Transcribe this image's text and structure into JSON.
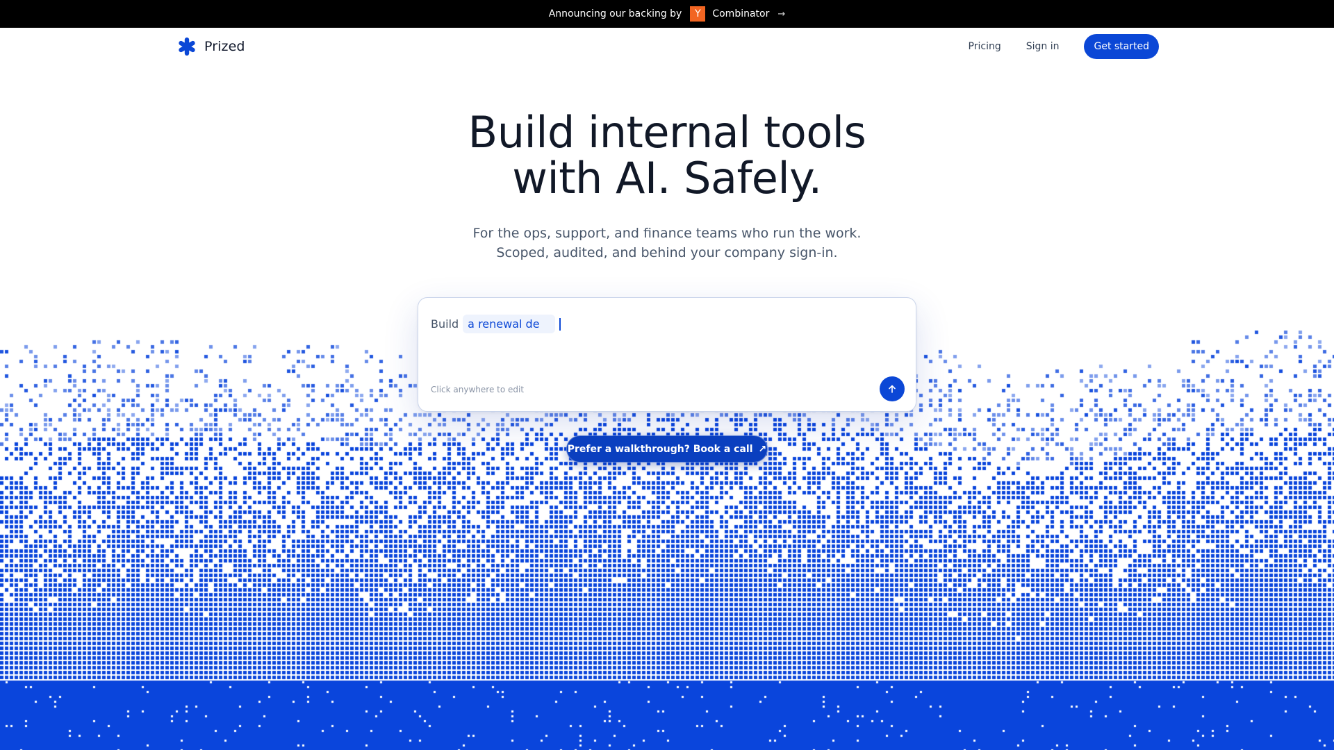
{
  "announcement": {
    "prefix": "Announcing our backing by",
    "badge": "Y",
    "suffix": "Combinator",
    "arrow": "→"
  },
  "nav": {
    "brand": "Prized",
    "links": [
      "Pricing",
      "Sign in"
    ],
    "cta": "Get started"
  },
  "hero": {
    "title_line1": "Build internal tools",
    "title_line2": "with AI. Safely.",
    "subtitle": "For the ops, support, and finance teams who run the work. Scoped, audited, and behind your company sign-in."
  },
  "prompt": {
    "prefix": "Build",
    "chip_text": "a renewal de",
    "hint": "Click anywhere to edit"
  },
  "walkthrough": {
    "label": "Prefer a walkthrough? Book a call",
    "arrow": "↗"
  },
  "colors": {
    "accent": "#0b47d6",
    "pixel": "#0a45dc",
    "yc": "#f26522"
  },
  "icons": {
    "brand": "asterisk-logo-icon",
    "send": "arrow-up-icon",
    "external": "arrow-up-right-icon"
  }
}
